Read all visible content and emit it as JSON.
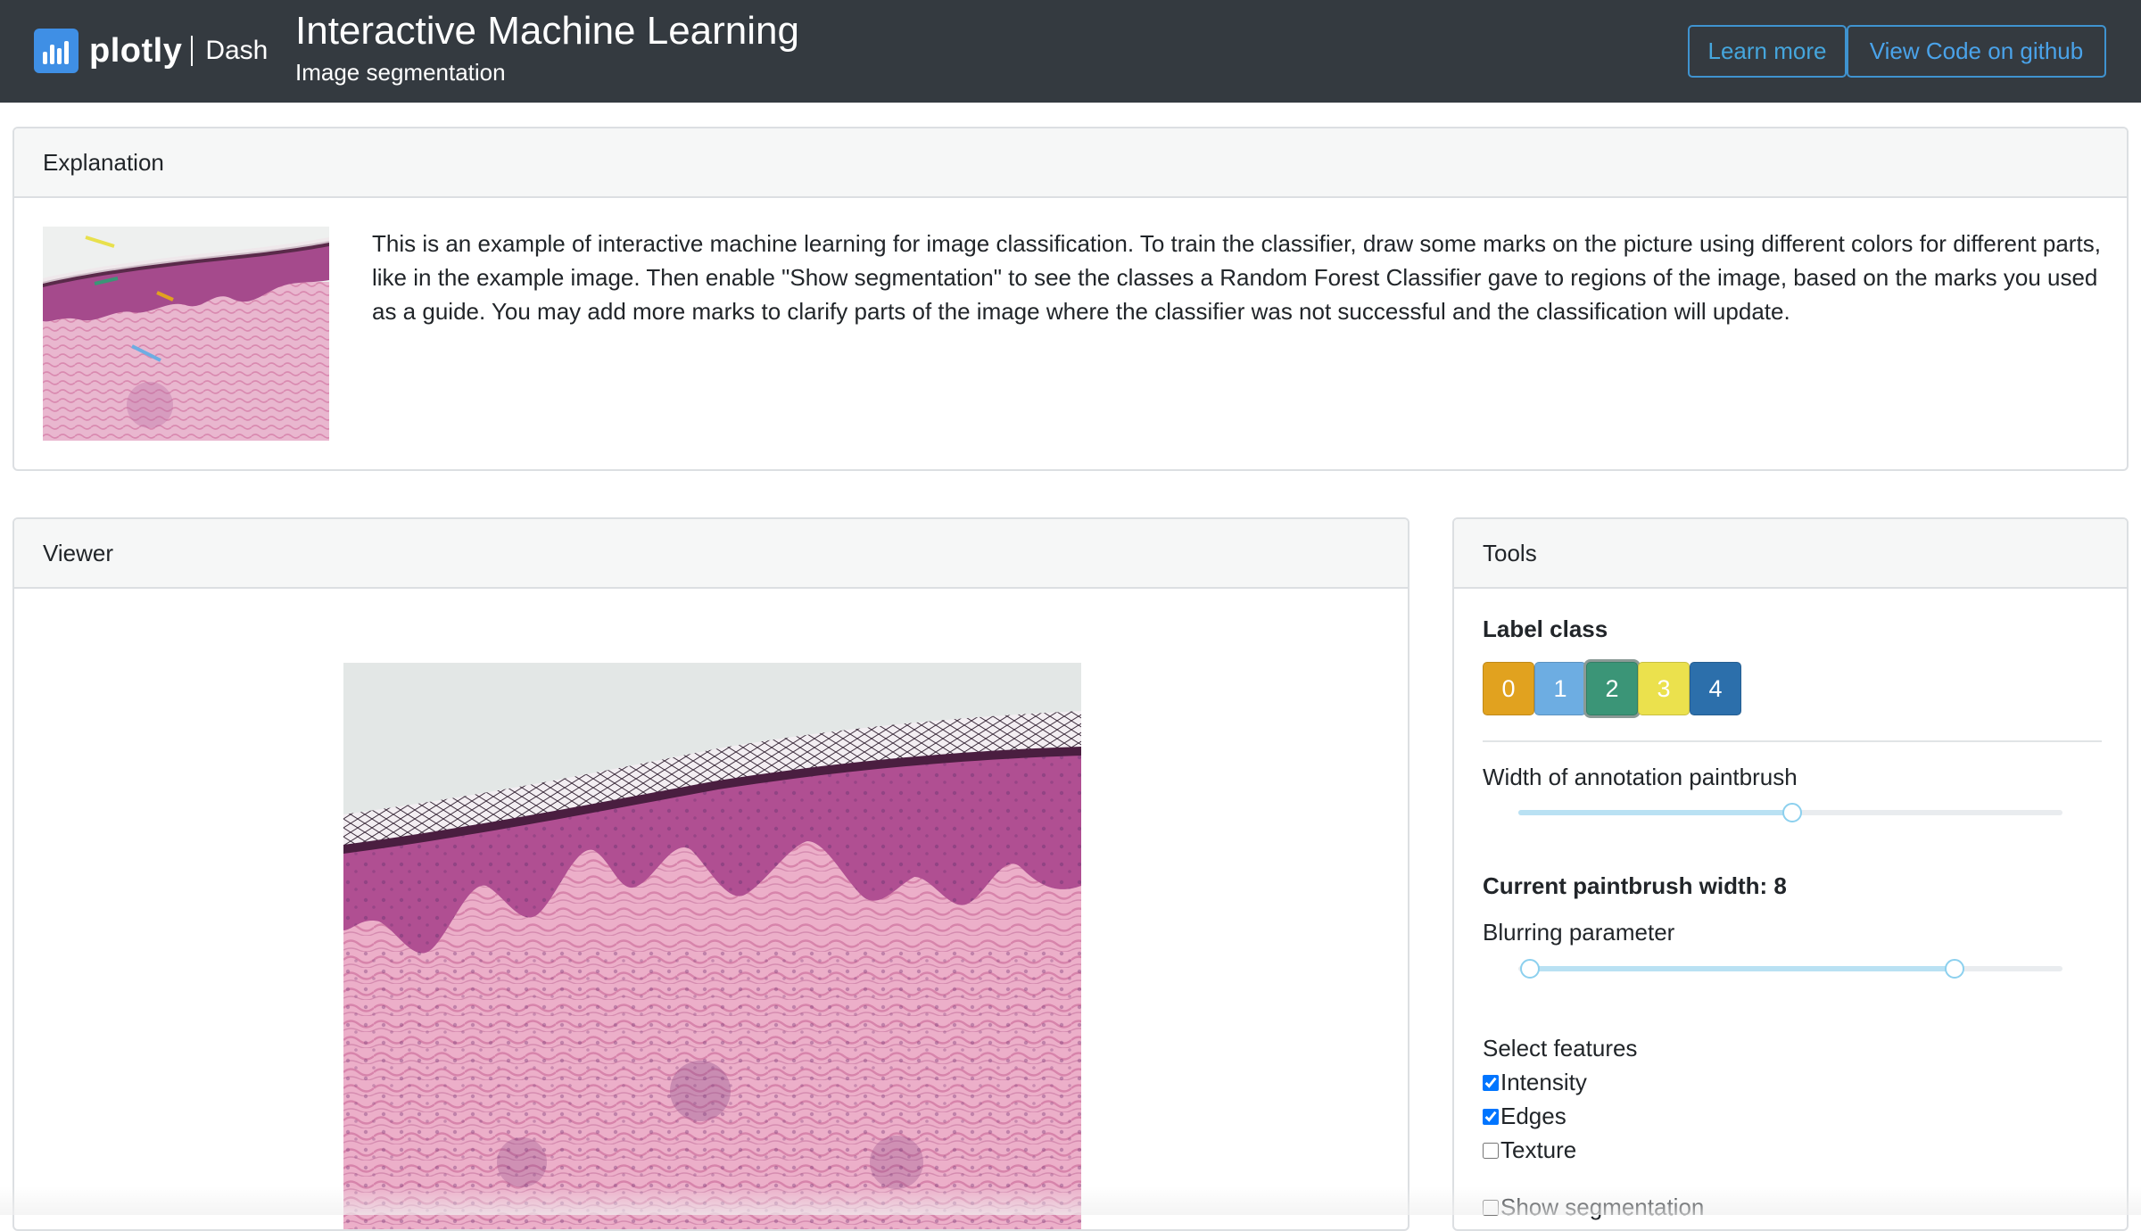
{
  "navbar": {
    "brand": {
      "word": "plotly",
      "product": "Dash"
    },
    "title": "Interactive Machine Learning",
    "subtitle": "Image segmentation",
    "learn_more_label": "Learn more",
    "github_label": "View Code on github"
  },
  "explanation": {
    "header": "Explanation",
    "text": "This is an example of interactive machine learning for image classification. To train the classifier, draw some marks on the picture using different colors for different parts, like in the example image. Then enable \"Show segmentation\" to see the classes a Random Forest Classifier gave to regions of the image, based on the marks you used as a guide. You may add more marks to clarify parts of the image where the classifier was not successful and the classification will update."
  },
  "viewer": {
    "header": "Viewer"
  },
  "tools": {
    "header": "Tools",
    "label_class_title": "Label class",
    "classes": [
      {
        "label": "0",
        "color": "#e1a21f"
      },
      {
        "label": "1",
        "color": "#6dade2"
      },
      {
        "label": "2",
        "color": "#3b9577",
        "selected": true
      },
      {
        "label": "3",
        "color": "#ebe14d"
      },
      {
        "label": "4",
        "color": "#2c6fab"
      }
    ],
    "width_label": "Width of annotation paintbrush",
    "width_slider_value": 0.5,
    "current_width_label": "Current paintbrush width: 8",
    "blur_label": "Blurring parameter",
    "blur_range": [
      0.02,
      0.8
    ],
    "features_title": "Select features",
    "features": [
      {
        "label": "Intensity",
        "checked": true
      },
      {
        "label": "Edges",
        "checked": true
      },
      {
        "label": "Texture",
        "checked": false
      }
    ],
    "show_segmentation_label": "Show segmentation",
    "show_segmentation_checked": false
  },
  "colors": {
    "navbar_bg": "#343a40",
    "accent": "#3f93d0",
    "slider_fill": "#b9e1f3"
  }
}
